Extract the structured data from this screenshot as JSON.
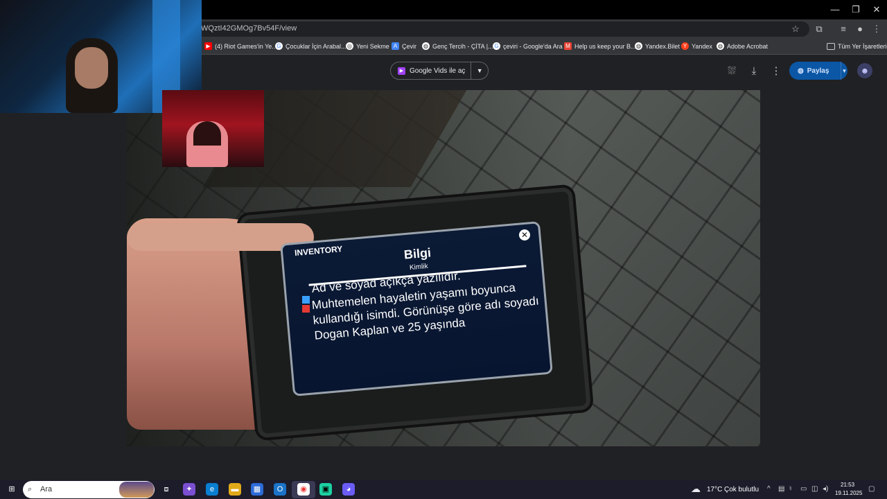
{
  "browser": {
    "url": "WQztI42GMOg7Bv54F/view",
    "bookmarks": [
      {
        "label": "(4) Riot Games'in Ye...",
        "icon": "youtube-icon",
        "color": "#ff0000"
      },
      {
        "label": "Çocuklar İçin Arabal...",
        "icon": "google-icon",
        "color": "#ffffff"
      },
      {
        "label": "Yeni Sekme",
        "icon": "chrome-icon",
        "color": "#ffffff"
      },
      {
        "label": "Çevir",
        "icon": "translate-icon",
        "color": "#4285f4"
      },
      {
        "label": "Genç Tercih - ÇİTA |...",
        "icon": "globe-icon",
        "color": "#ffffff"
      },
      {
        "label": "çeviri - Google'da Ara",
        "icon": "google-icon",
        "color": "#ffffff"
      },
      {
        "label": "Help us keep your B...",
        "icon": "gmail-icon",
        "color": "#ea4335"
      },
      {
        "label": "Yandex.Bilet",
        "icon": "globe-icon",
        "color": "#ffffff"
      },
      {
        "label": "Yandex",
        "icon": "yandex-icon",
        "color": "#fc3f1d"
      },
      {
        "label": "Adobe Acrobat",
        "icon": "globe-icon",
        "color": "#ffffff"
      }
    ],
    "all_bookmarks": "Tüm Yer İşaretleri"
  },
  "drive": {
    "open_with": "Google Vids ile aç",
    "share": "Paylaş"
  },
  "game": {
    "inventory_label": "INVENTORY",
    "title": "Bilgi",
    "subtitle": "Kimlik",
    "line1": "Ad ve soyad açıkça yazılıdır.",
    "line2": "Muhtemelen hayaletin yaşamı boyunca kullandığı isimdi. Görünüşe göre adı soyadı Dogan Kaplan ve 25 yaşında"
  },
  "taskbar": {
    "search_placeholder": "Ara",
    "temperature": "17°C",
    "weather": "Çok bulutlu",
    "time": "21:53",
    "date": "19.11.2025"
  }
}
